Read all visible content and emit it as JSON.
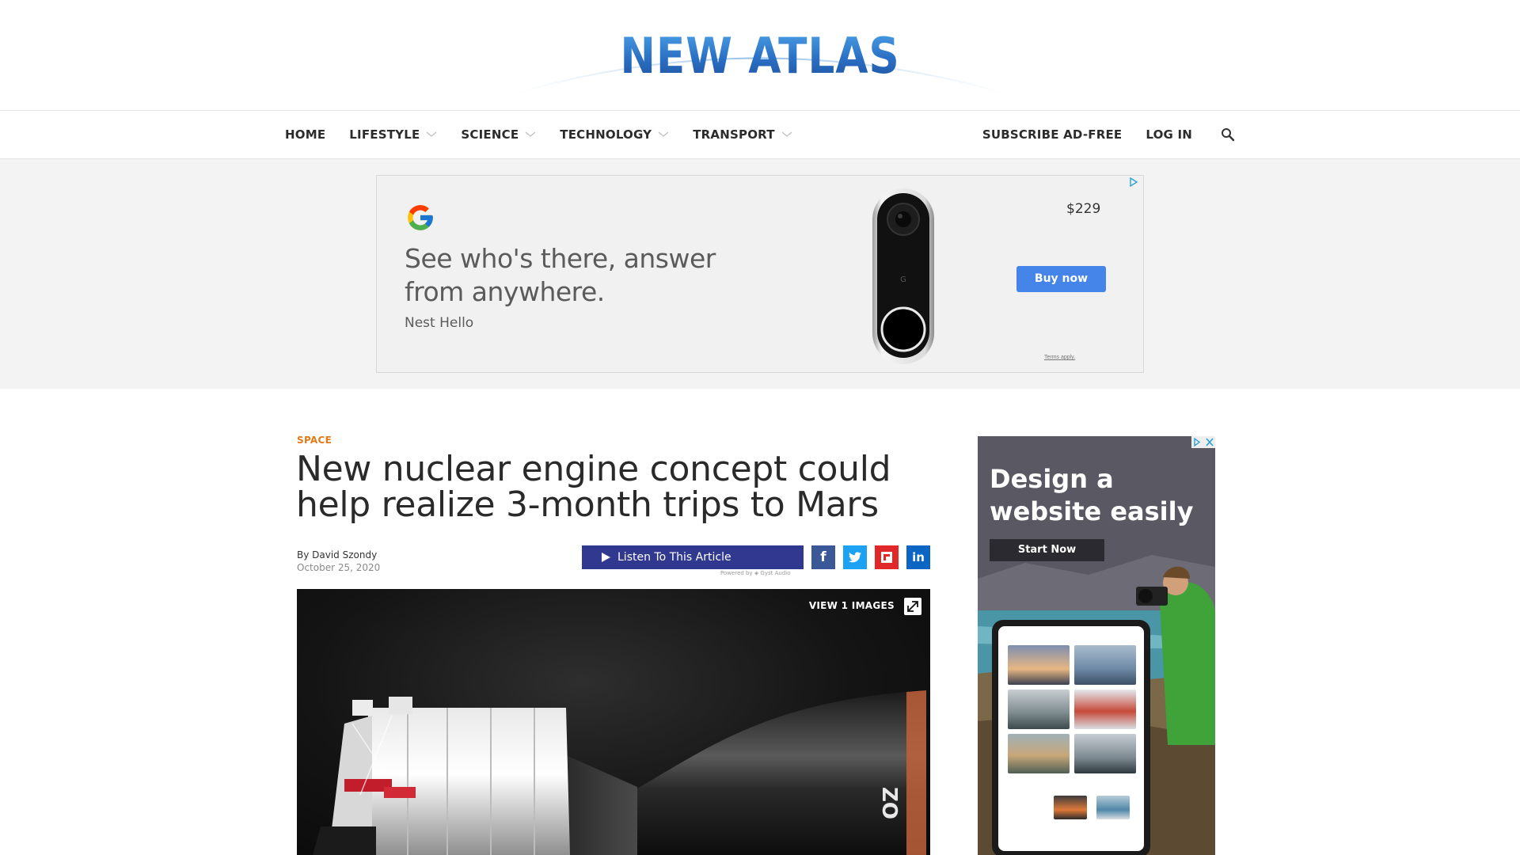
{
  "site": {
    "logo_text": "NEW ATLAS"
  },
  "nav": {
    "left": [
      {
        "label": "HOME",
        "has_dropdown": false
      },
      {
        "label": "LIFESTYLE",
        "has_dropdown": true
      },
      {
        "label": "SCIENCE",
        "has_dropdown": true
      },
      {
        "label": "TECHNOLOGY",
        "has_dropdown": true
      },
      {
        "label": "TRANSPORT",
        "has_dropdown": true
      }
    ],
    "right": [
      {
        "label": "SUBSCRIBE AD-FREE"
      },
      {
        "label": "LOG IN"
      }
    ],
    "search_icon": "search-icon"
  },
  "ad_top": {
    "headline": "See who's there, answer from anywhere.",
    "brand": "Nest Hello",
    "price": "$229",
    "button": "Buy now",
    "terms": "Terms apply.",
    "colors": {
      "button": "#4585ea"
    }
  },
  "article": {
    "category": "SPACE",
    "headline": "New nuclear engine concept could help realize 3-month trips to Mars",
    "byline": "By David Szondy",
    "date": "October 25, 2020",
    "listen_label": "Listen To This Article",
    "powered_by": "Powered by",
    "powered_brand": "Gyst Audio",
    "view_images": "VIEW 1 IMAGES",
    "share": [
      {
        "network": "facebook",
        "glyph": "f",
        "color": "#3b5998"
      },
      {
        "network": "twitter",
        "glyph": "twitter-icon",
        "color": "#1da1f2"
      },
      {
        "network": "flipboard",
        "glyph": "flipboard-icon",
        "color": "#e02828"
      },
      {
        "network": "linkedin",
        "glyph": "in",
        "color": "#0a66c2"
      }
    ],
    "colors": {
      "category": "#e07a1a",
      "listen_button": "#30388f"
    }
  },
  "ad_right": {
    "headline": "Design a website easily",
    "button": "Start Now"
  }
}
